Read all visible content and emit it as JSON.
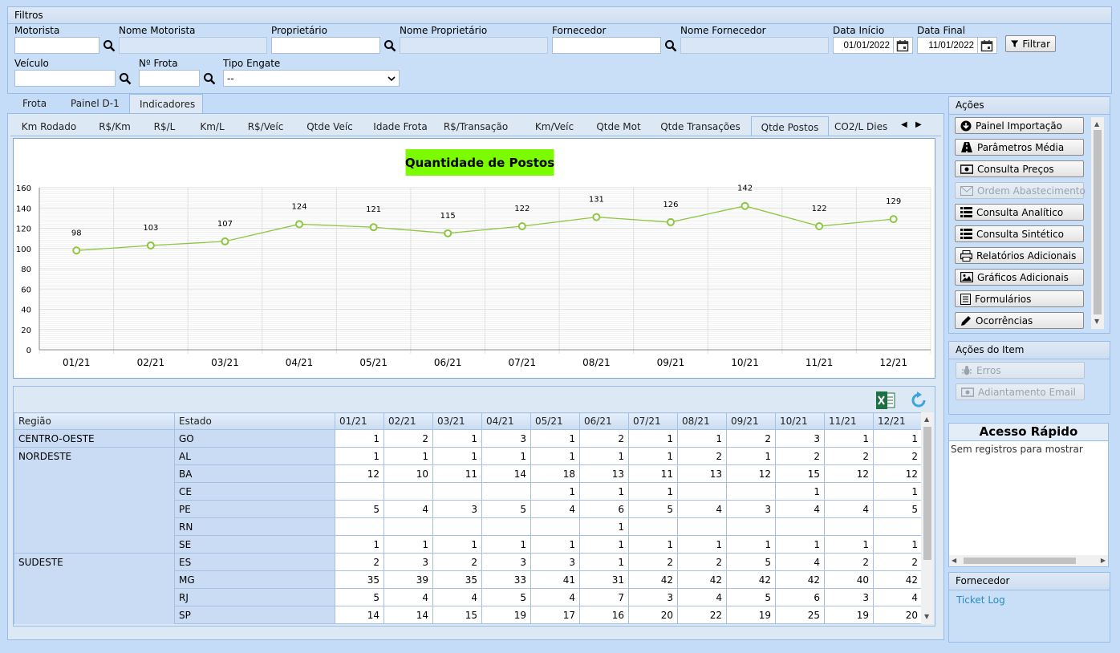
{
  "filters": {
    "title": "Filtros",
    "motorista_label": "Motorista",
    "nome_motorista_label": "Nome Motorista",
    "proprietario_label": "Proprietário",
    "nome_proprietario_label": "Nome Proprietário",
    "fornecedor_label": "Fornecedor",
    "nome_fornecedor_label": "Nome Fornecedor",
    "data_inicio_label": "Data Início",
    "data_inicio_value": "01/01/2022",
    "data_final_label": "Data Final",
    "data_final_value": "11/01/2022",
    "filtrar_label": "Filtrar",
    "veiculo_label": "Veículo",
    "frota_label": "Nº Frota",
    "tipo_engate_label": "Tipo Engate",
    "tipo_engate_value": "--"
  },
  "main_tabs": [
    "Frota",
    "Painel D-1",
    "Indicadores"
  ],
  "indicator_tabs": [
    "Km Rodado",
    "R$/Km",
    "R$/L",
    "Km/L",
    "R$/Veíc",
    "Qtde Veíc",
    "Idade Frota",
    "R$/Transação",
    "Km/Veíc",
    "Qtde Mot",
    "Qtde Transações",
    "Qtde Postos",
    "CO2/L Dies"
  ],
  "chart_data": {
    "type": "line",
    "title": "Quantidade de Postos",
    "categories": [
      "01/21",
      "02/21",
      "03/21",
      "04/21",
      "05/21",
      "06/21",
      "07/21",
      "08/21",
      "09/21",
      "10/21",
      "11/21",
      "12/21"
    ],
    "values": [
      98,
      103,
      107,
      124,
      121,
      115,
      122,
      131,
      126,
      142,
      122,
      129
    ],
    "ylim": [
      0,
      160
    ],
    "yticks": [
      "0",
      "20",
      "40",
      "60",
      "80",
      "100",
      "120",
      "140",
      "160"
    ],
    "grid": true,
    "line_color": "#8dc63f",
    "title_bg": "#7cfc00"
  },
  "table": {
    "col_regiao": "Região",
    "col_estado": "Estado",
    "months": [
      "01/21",
      "02/21",
      "03/21",
      "04/21",
      "05/21",
      "06/21",
      "07/21",
      "08/21",
      "09/21",
      "10/21",
      "11/21",
      "12/21"
    ],
    "rows": [
      {
        "regiao": "CENTRO-OESTE",
        "estado": "GO",
        "v": [
          "1",
          "2",
          "1",
          "3",
          "1",
          "2",
          "1",
          "1",
          "2",
          "3",
          "1",
          "1"
        ]
      },
      {
        "regiao": "NORDESTE",
        "estado": "AL",
        "v": [
          "1",
          "1",
          "1",
          "1",
          "1",
          "1",
          "1",
          "2",
          "1",
          "2",
          "2",
          "2"
        ]
      },
      {
        "regiao": "",
        "estado": "BA",
        "v": [
          "12",
          "10",
          "11",
          "14",
          "18",
          "13",
          "11",
          "13",
          "12",
          "15",
          "12",
          "12"
        ]
      },
      {
        "regiao": "",
        "estado": "CE",
        "v": [
          "",
          "",
          "",
          "",
          "1",
          "1",
          "1",
          "",
          "",
          "1",
          "",
          "1"
        ]
      },
      {
        "regiao": "",
        "estado": "PE",
        "v": [
          "5",
          "4",
          "3",
          "5",
          "4",
          "6",
          "5",
          "4",
          "3",
          "4",
          "4",
          "5"
        ]
      },
      {
        "regiao": "",
        "estado": "RN",
        "v": [
          "",
          "",
          "",
          "",
          "",
          "1",
          "",
          "",
          "",
          "",
          "",
          ""
        ]
      },
      {
        "regiao": "",
        "estado": "SE",
        "v": [
          "1",
          "1",
          "1",
          "1",
          "1",
          "1",
          "1",
          "1",
          "1",
          "1",
          "1",
          "1"
        ]
      },
      {
        "regiao": "SUDESTE",
        "estado": "ES",
        "v": [
          "2",
          "3",
          "2",
          "3",
          "3",
          "1",
          "2",
          "2",
          "5",
          "4",
          "2",
          "2"
        ]
      },
      {
        "regiao": "",
        "estado": "MG",
        "v": [
          "35",
          "39",
          "35",
          "33",
          "41",
          "31",
          "42",
          "42",
          "42",
          "42",
          "40",
          "42"
        ]
      },
      {
        "regiao": "",
        "estado": "RJ",
        "v": [
          "5",
          "4",
          "4",
          "5",
          "4",
          "7",
          "3",
          "4",
          "5",
          "6",
          "3",
          "4"
        ]
      },
      {
        "regiao": "",
        "estado": "SP",
        "v": [
          "14",
          "14",
          "15",
          "19",
          "17",
          "16",
          "20",
          "22",
          "19",
          "25",
          "19",
          "20"
        ]
      }
    ]
  },
  "acoes": {
    "title": "Ações",
    "items": [
      {
        "label": "Painel Importação",
        "icon": "download-circle-icon",
        "disabled": false
      },
      {
        "label": "Parâmetros Média",
        "icon": "road-icon",
        "disabled": false
      },
      {
        "label": "Consulta Preços",
        "icon": "money-icon",
        "disabled": false
      },
      {
        "label": "Ordem Abastecimento",
        "icon": "envelope-icon",
        "disabled": true
      },
      {
        "label": "Consulta Analítico",
        "icon": "list-icon",
        "disabled": false
      },
      {
        "label": "Consulta Sintético",
        "icon": "list-icon",
        "disabled": false
      },
      {
        "label": "Relatórios Adicionais",
        "icon": "print-icon",
        "disabled": false
      },
      {
        "label": "Gráficos Adicionais",
        "icon": "image-icon",
        "disabled": false
      },
      {
        "label": "Formulários",
        "icon": "form-icon",
        "disabled": false
      },
      {
        "label": "Ocorrências",
        "icon": "pencil-icon",
        "disabled": false
      }
    ]
  },
  "acoes_item": {
    "title": "Ações do Item",
    "items": [
      {
        "label": "Erros",
        "icon": "bug-icon"
      },
      {
        "label": "Adiantamento Email",
        "icon": "money-icon"
      }
    ]
  },
  "acesso_rapido": {
    "title": "Acesso Rápido",
    "empty": "Sem registros para mostrar"
  },
  "fornecedor": {
    "title": "Fornecedor",
    "link": "Ticket Log"
  }
}
